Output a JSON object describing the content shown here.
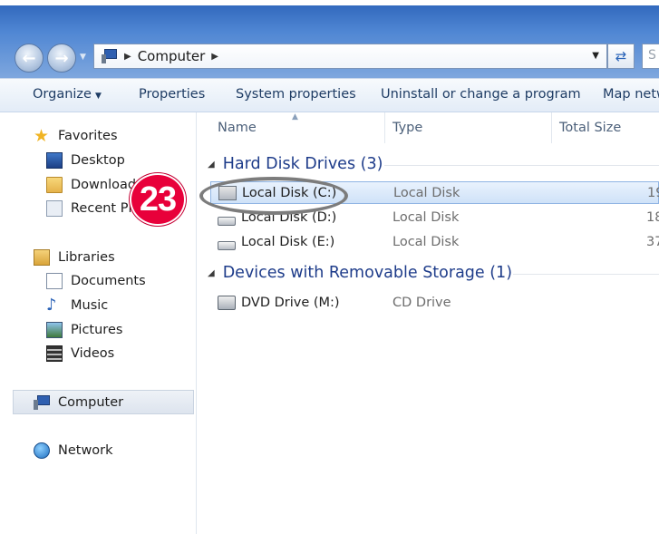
{
  "address": {
    "location": "Computer",
    "search_placeholder": "S"
  },
  "toolbar": {
    "organize": "Organize",
    "properties": "Properties",
    "system_properties": "System properties",
    "uninstall": "Uninstall or change a program",
    "map_network": "Map netw"
  },
  "nav": {
    "favorites": "Favorites",
    "desktop": "Desktop",
    "downloads": "Download",
    "recent": "Recent Pla",
    "libraries": "Libraries",
    "documents": "Documents",
    "music": "Music",
    "pictures": "Pictures",
    "videos": "Videos",
    "computer": "Computer",
    "network": "Network"
  },
  "columns": {
    "name": "Name",
    "type": "Type",
    "total_size": "Total Size"
  },
  "groups": {
    "hard_disks": "Hard Disk Drives (3)",
    "removable": "Devices with Removable Storage (1)"
  },
  "drives": [
    {
      "name": "Local Disk (C:)",
      "type": "Local Disk",
      "size": "19"
    },
    {
      "name": "Local Disk (D:)",
      "type": "Local Disk",
      "size": "18"
    },
    {
      "name": "Local Disk (E:)",
      "type": "Local Disk",
      "size": "37"
    }
  ],
  "removable": [
    {
      "name": "DVD Drive (M:)",
      "type": "CD Drive"
    }
  ],
  "annotation": {
    "step": "23"
  },
  "colors": {
    "accent": "#1e3c8a",
    "badge": "#e8003a"
  }
}
